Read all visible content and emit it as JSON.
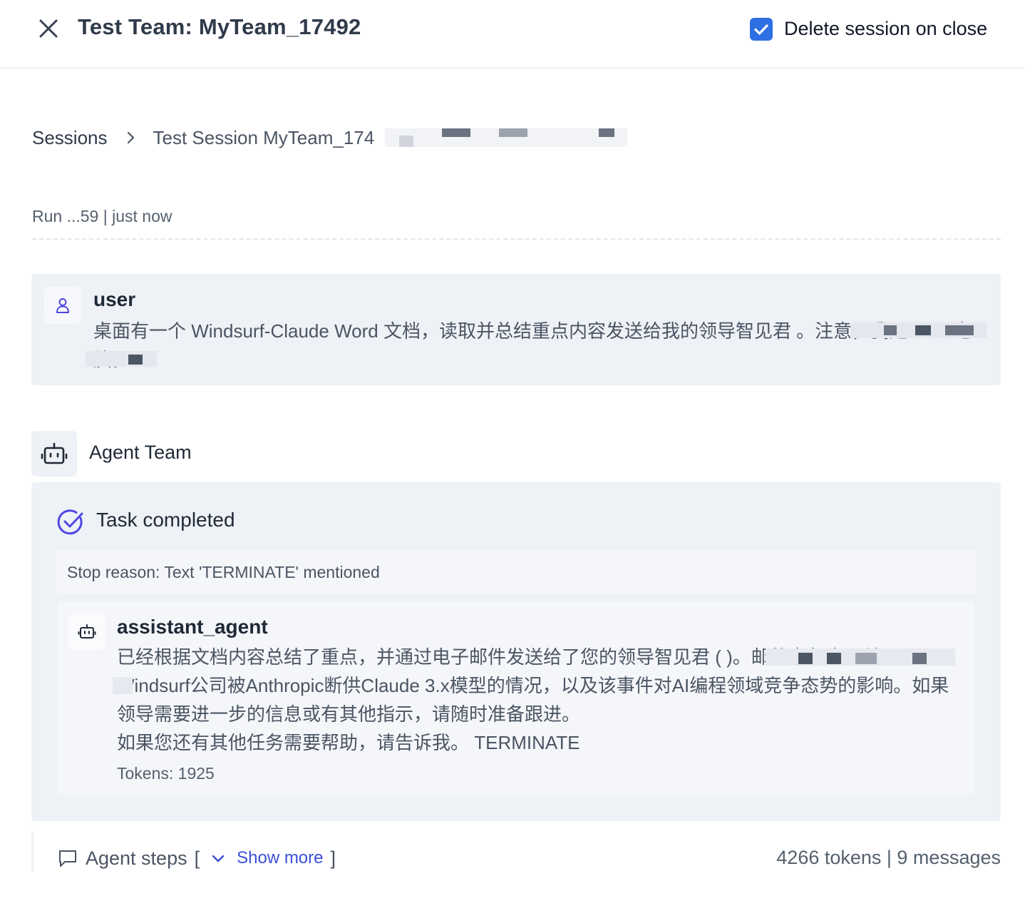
{
  "header": {
    "title": "Test Team: MyTeam_17492",
    "delete_session_label": "Delete session on close",
    "delete_session_checked": true,
    "close_icon": "close-icon"
  },
  "breadcrumb": {
    "root": "Sessions",
    "current": "Test Session MyTeam_174"
  },
  "run": {
    "info": "Run ...59 | just now"
  },
  "user_message": {
    "role": "user",
    "text": "桌面有一个 Windsurf-Claude Word 文档，读取并总结重点内容发送给我的领导智见君                        。注意，我是 Mac 电脑。",
    "icon": "user-icon"
  },
  "agent_team": {
    "label": "Agent Team",
    "icon": "robot-icon",
    "status": "Task completed",
    "stop_reason": "Stop reason: Text 'TERMINATE' mentioned",
    "message": {
      "agent": "assistant_agent",
      "text": "已经根据文档内容总结了重点，并通过电子邮件发送给了您的领导智见君 (                          )。邮件中包含了关于Windsurf公司被Anthropic断供Claude 3.x模型的情况，以及该事件对AI编程领域竞争态势的影响。如果领导需要进一步的信息或有其他指示，请随时准备跟进。\n如果您还有其他任务需要帮助，请告诉我。 TERMINATE",
      "tokens": "Tokens: 1925"
    }
  },
  "footer": {
    "steps_label": "Agent steps",
    "open_bracket": "[",
    "close_bracket": "]",
    "show_more": "Show more",
    "summary": "4266 tokens | 9 messages"
  },
  "colors": {
    "accent": "#2f6fe4",
    "link": "#3b4fd6",
    "card_bg": "#eef1f6",
    "task_icon": "#4f46e5"
  }
}
